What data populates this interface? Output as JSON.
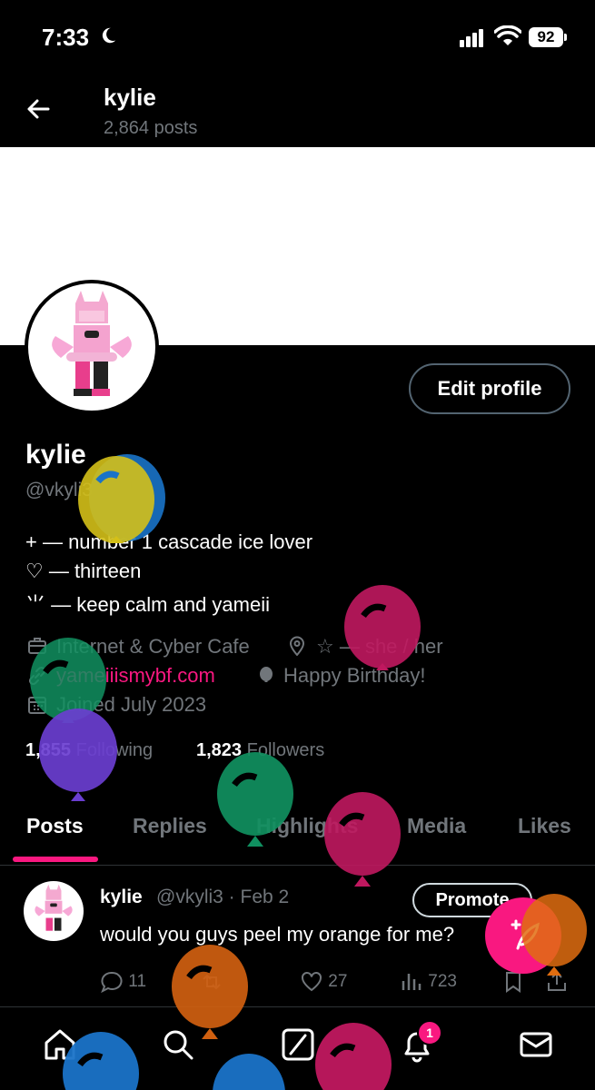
{
  "status_bar": {
    "time": "7:33",
    "battery": "92"
  },
  "header": {
    "name": "kylie",
    "posts_count": "2,864 posts"
  },
  "profile": {
    "edit_label": "Edit profile",
    "name": "kylie",
    "handle": "@vkyli3",
    "bio": [
      "+ — number 1 cascade ice lover",
      "♡ — thirteen",
      "⺌ — keep calm and yameii"
    ],
    "category": "Internet & Cyber Cafe",
    "location": "☆ — she / her",
    "website": "yameiiismybf.com",
    "birthday": "Happy Birthday!",
    "joined": "Joined July 2023",
    "following_count": "1,855",
    "following_label": "Following",
    "followers_count": "1,823",
    "followers_label": "Followers"
  },
  "tabs": [
    {
      "label": "Posts",
      "active": true
    },
    {
      "label": "Replies"
    },
    {
      "label": "Highlights"
    },
    {
      "label": "Media"
    },
    {
      "label": "Likes"
    }
  ],
  "post": {
    "name": "kylie",
    "meta": "@vkyli3 · Feb 2",
    "promote_label": "Promote",
    "text": "would you guys peel my orange for me?",
    "replies": "11",
    "likes": "27",
    "views": "723"
  },
  "notifications_badge": "1",
  "colors": {
    "accent": "#f91880",
    "background": "#000000",
    "muted": "#71767b"
  }
}
